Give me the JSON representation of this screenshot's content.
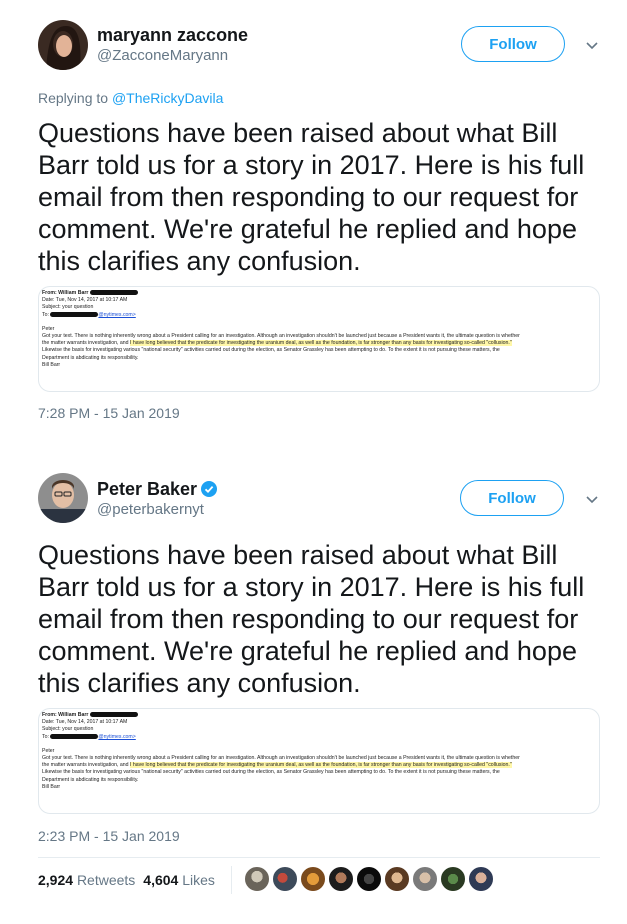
{
  "tweet1": {
    "display_name": "maryann zaccone",
    "handle": "@ZacconeMaryann",
    "follow_label": "Follow",
    "replying_prefix": "Replying to ",
    "replying_to": "@TheRickyDavila",
    "text": "Questions have been raised about what Bill Barr told us for a story in 2017. Here is his full email from then responding to our request for comment. We're grateful he replied and hope this clarifies any confusion.",
    "timestamp": "7:28 PM - 15 Jan 2019"
  },
  "tweet2": {
    "display_name": "Peter Baker",
    "handle": "@peterbakernyt",
    "follow_label": "Follow",
    "text": "Questions have been raised about what Bill Barr told us for a story in 2017. Here is his full email from then responding to our request for comment. We're grateful he replied and hope this clarifies any confusion.",
    "timestamp": "2:23 PM - 15 Jan 2019"
  },
  "email": {
    "from_label": "From: William Barr",
    "date_line": "Date: Tue, Nov 14, 2017 at 10:17 AM",
    "subject_line": "Subject: your question",
    "to_label": "To:",
    "to_domain": "@nytimes.com>",
    "greeting": "Peter",
    "line1a": "Got your text. There is nothing inherently wrong about a President calling for an investigation.  Although an investigation shouldn't be launched just because a President wants it, the ultimate question is whether",
    "line2a": "the matter warrants investigation, and ",
    "line2b": "I have long believed that the predicate for investigating the uranium deal, as well as the foundation, is far stronger than any basis for investigating so-called \"collusion.\"",
    "line3": "Likewise the basis for investigating various \"national security\" activities carried out during the election, as Senator Grassley has been attempting to do.  To the extent it is not pursuing these matters, the",
    "line4": "Department is abdicating its responsibility.",
    "signoff": "Bill Barr"
  },
  "stats": {
    "retweets_count": "2,924",
    "retweets_label": "Retweets",
    "likes_count": "4,604",
    "likes_label": "Likes"
  },
  "colors": {
    "accent": "#1da1f2",
    "verified": "#1da1f2",
    "muted": "#657786",
    "highlight": "#fff7a8"
  },
  "icons": {
    "chevron": "chevron-down-icon",
    "verified": "verified-badge-icon"
  }
}
